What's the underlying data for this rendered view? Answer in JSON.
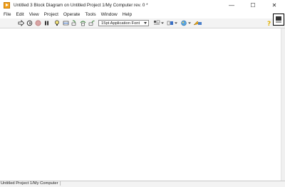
{
  "window": {
    "title": "Untitled 3 Block Diagram on Untitled Project 1/My Computer rev. 0 *",
    "controls": {
      "minimize": "—",
      "maximize": "☐",
      "close": "✕"
    }
  },
  "menubar": {
    "items": [
      {
        "label": "File"
      },
      {
        "label": "Edit"
      },
      {
        "label": "View"
      },
      {
        "label": "Project"
      },
      {
        "label": "Operate"
      },
      {
        "label": "Tools"
      },
      {
        "label": "Window"
      },
      {
        "label": "Help"
      }
    ]
  },
  "toolbar": {
    "tools": [
      {
        "name": "run-arrow-icon"
      },
      {
        "name": "run-continuously-icon"
      },
      {
        "name": "abort-execution-icon"
      },
      {
        "name": "pause-icon"
      },
      {
        "name": "highlight-execution-icon"
      },
      {
        "name": "retain-wire-values-icon"
      },
      {
        "name": "step-into-icon"
      },
      {
        "name": "step-over-icon"
      },
      {
        "name": "step-out-icon"
      }
    ],
    "font": {
      "label": "15pt Application Font"
    },
    "arrange": [
      {
        "name": "align-objects-icon"
      },
      {
        "name": "distribute-objects-icon"
      },
      {
        "name": "reorder-icon"
      },
      {
        "name": "clean-up-diagram-icon"
      }
    ],
    "help_icon": "context-help-icon"
  },
  "statusbar": {
    "context": "Untitled Project 1/My Computer"
  },
  "colors": {
    "app_icon": "#f4a21b",
    "toolbar_bg": "#f3f3f3",
    "canvas_bg": "#ffffff"
  }
}
